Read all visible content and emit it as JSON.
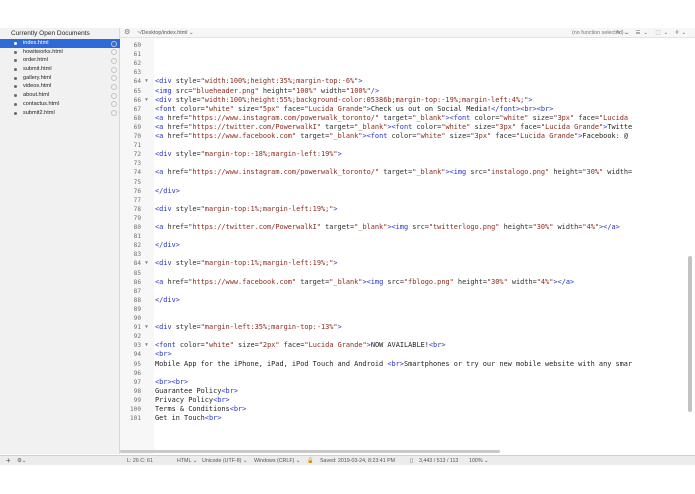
{
  "sidebar": {
    "header": "Currently Open Documents",
    "files": [
      "index.html",
      "howitworks.html",
      "order.html",
      "submit.html",
      "gallery.html",
      "videos.html",
      "about.html",
      "contactus.html",
      "submit2.html"
    ],
    "selected_index": 0
  },
  "topbar": {
    "gear": "⚙",
    "path": "~/Desktop/index.html ⌄",
    "function_menu": "(no function selected) ⌄",
    "icons": "✎⌄ ☰⌄ ⬚⌄ #⌄"
  },
  "editor": {
    "lines": [
      {
        "n": "60",
        "fold": "",
        "segs": []
      },
      {
        "n": "61",
        "fold": "",
        "segs": []
      },
      {
        "n": "62",
        "fold": "",
        "segs": []
      },
      {
        "n": "63",
        "fold": "",
        "segs": []
      },
      {
        "n": "64",
        "fold": "▼",
        "segs": [
          {
            "t": "<div ",
            "c": "t-tag"
          },
          {
            "t": "style=",
            "c": "t-attr"
          },
          {
            "t": "\"width:100%;height:35%;margin-top:-6%\"",
            "c": "t-val"
          },
          {
            "t": ">",
            "c": "t-tag"
          }
        ]
      },
      {
        "n": "65",
        "fold": "",
        "segs": [
          {
            "t": "<img ",
            "c": "t-tag"
          },
          {
            "t": "src=",
            "c": "t-attr"
          },
          {
            "t": "\"blueheader.png\" ",
            "c": "t-val"
          },
          {
            "t": "height=",
            "c": "t-attr"
          },
          {
            "t": "\"100%\" ",
            "c": "t-val"
          },
          {
            "t": "width=",
            "c": "t-attr"
          },
          {
            "t": "\"100%\"",
            "c": "t-val"
          },
          {
            "t": "/>",
            "c": "t-tag"
          }
        ]
      },
      {
        "n": "66",
        "fold": "▼",
        "segs": [
          {
            "t": "<div ",
            "c": "t-tag"
          },
          {
            "t": "style=",
            "c": "t-attr"
          },
          {
            "t": "\"width:100%;height:55%;background-color:05386b;margin-top:-19%;margin-left:4%;\"",
            "c": "t-val"
          },
          {
            "t": ">",
            "c": "t-tag"
          }
        ]
      },
      {
        "n": "67",
        "fold": "",
        "segs": [
          {
            "t": "<font ",
            "c": "t-tag"
          },
          {
            "t": "color=",
            "c": "t-attr"
          },
          {
            "t": "\"white\" ",
            "c": "t-val"
          },
          {
            "t": "size=",
            "c": "t-attr"
          },
          {
            "t": "\"5px\" ",
            "c": "t-val"
          },
          {
            "t": "face=",
            "c": "t-attr"
          },
          {
            "t": "\"Lucida Grande\"",
            "c": "t-val"
          },
          {
            "t": ">",
            "c": "t-tag"
          },
          {
            "t": "Check us out on Social Media!",
            "c": "t-text"
          },
          {
            "t": "</font><br><br>",
            "c": "t-tag"
          }
        ]
      },
      {
        "n": "68",
        "fold": "",
        "segs": [
          {
            "t": "<a ",
            "c": "t-tag"
          },
          {
            "t": "href=",
            "c": "t-attr"
          },
          {
            "t": "\"https://www.instagram.com/powerwalk_toronto/\" ",
            "c": "t-val"
          },
          {
            "t": "target=",
            "c": "t-attr"
          },
          {
            "t": "\"_blank\"",
            "c": "t-val"
          },
          {
            "t": "><font ",
            "c": "t-tag"
          },
          {
            "t": "color=",
            "c": "t-attr"
          },
          {
            "t": "\"white\" ",
            "c": "t-val"
          },
          {
            "t": "size=",
            "c": "t-attr"
          },
          {
            "t": "\"3px\" ",
            "c": "t-val"
          },
          {
            "t": "face=",
            "c": "t-attr"
          },
          {
            "t": "\"Lucida",
            "c": "t-val"
          }
        ]
      },
      {
        "n": "69",
        "fold": "",
        "segs": [
          {
            "t": "<a ",
            "c": "t-tag"
          },
          {
            "t": "href=",
            "c": "t-attr"
          },
          {
            "t": "\"https://twitter.com/PowerwalkI\" ",
            "c": "t-val"
          },
          {
            "t": "target=",
            "c": "t-attr"
          },
          {
            "t": "\"_blank\"",
            "c": "t-val"
          },
          {
            "t": "><font ",
            "c": "t-tag"
          },
          {
            "t": "color=",
            "c": "t-attr"
          },
          {
            "t": "\"white\" ",
            "c": "t-val"
          },
          {
            "t": "size=",
            "c": "t-attr"
          },
          {
            "t": "\"3px\" ",
            "c": "t-val"
          },
          {
            "t": "face=",
            "c": "t-attr"
          },
          {
            "t": "\"Lucida Grande\"",
            "c": "t-val"
          },
          {
            "t": ">",
            "c": "t-tag"
          },
          {
            "t": "Twitte",
            "c": "t-text"
          }
        ]
      },
      {
        "n": "70",
        "fold": "",
        "segs": [
          {
            "t": "<a ",
            "c": "t-tag"
          },
          {
            "t": "href=",
            "c": "t-attr"
          },
          {
            "t": "\"https://www.facebook.com\" ",
            "c": "t-val"
          },
          {
            "t": "target=",
            "c": "t-attr"
          },
          {
            "t": "\"_blank\"",
            "c": "t-val"
          },
          {
            "t": "><font ",
            "c": "t-tag"
          },
          {
            "t": "color=",
            "c": "t-attr"
          },
          {
            "t": "\"white\" ",
            "c": "t-val"
          },
          {
            "t": "size=",
            "c": "t-attr"
          },
          {
            "t": "\"3px\" ",
            "c": "t-val"
          },
          {
            "t": "face=",
            "c": "t-attr"
          },
          {
            "t": "\"Lucida Grande\"",
            "c": "t-val"
          },
          {
            "t": ">",
            "c": "t-tag"
          },
          {
            "t": "Facebook: @",
            "c": "t-text"
          }
        ]
      },
      {
        "n": "71",
        "fold": "",
        "segs": []
      },
      {
        "n": "72",
        "fold": "",
        "segs": [
          {
            "t": "<div ",
            "c": "t-tag"
          },
          {
            "t": "style=",
            "c": "t-attr"
          },
          {
            "t": "\"margin-top:-18%;margin-left:19%\"",
            "c": "t-val"
          },
          {
            "t": ">",
            "c": "t-tag"
          }
        ]
      },
      {
        "n": "73",
        "fold": "",
        "segs": []
      },
      {
        "n": "74",
        "fold": "",
        "segs": [
          {
            "t": "<a ",
            "c": "t-tag"
          },
          {
            "t": "href=",
            "c": "t-attr"
          },
          {
            "t": "\"https://www.instagram.com/powerwalk_toronto/\" ",
            "c": "t-val"
          },
          {
            "t": "target=",
            "c": "t-attr"
          },
          {
            "t": "\"_blank\"",
            "c": "t-val"
          },
          {
            "t": "><img ",
            "c": "t-tag"
          },
          {
            "t": "src=",
            "c": "t-attr"
          },
          {
            "t": "\"instalogo.png\" ",
            "c": "t-val"
          },
          {
            "t": "height=",
            "c": "t-attr"
          },
          {
            "t": "\"30%\" ",
            "c": "t-val"
          },
          {
            "t": "width=",
            "c": "t-attr"
          }
        ]
      },
      {
        "n": "75",
        "fold": "",
        "segs": []
      },
      {
        "n": "76",
        "fold": "",
        "segs": [
          {
            "t": "</div>",
            "c": "t-tag"
          }
        ]
      },
      {
        "n": "77",
        "fold": "",
        "segs": []
      },
      {
        "n": "78",
        "fold": "",
        "segs": [
          {
            "t": "<div ",
            "c": "t-tag"
          },
          {
            "t": "style=",
            "c": "t-attr"
          },
          {
            "t": "\"margin-top:1%;margin-left:19%;\"",
            "c": "t-val"
          },
          {
            "t": ">",
            "c": "t-tag"
          }
        ]
      },
      {
        "n": "79",
        "fold": "",
        "segs": []
      },
      {
        "n": "80",
        "fold": "",
        "segs": [
          {
            "t": "<a ",
            "c": "t-tag"
          },
          {
            "t": "href=",
            "c": "t-attr"
          },
          {
            "t": "\"https://twitter.com/PowerwalkI\" ",
            "c": "t-val"
          },
          {
            "t": "target=",
            "c": "t-attr"
          },
          {
            "t": "\"_blank\"",
            "c": "t-val"
          },
          {
            "t": "><img ",
            "c": "t-tag"
          },
          {
            "t": "src=",
            "c": "t-attr"
          },
          {
            "t": "\"twitterlogo.png\" ",
            "c": "t-val"
          },
          {
            "t": "height=",
            "c": "t-attr"
          },
          {
            "t": "\"30%\" ",
            "c": "t-val"
          },
          {
            "t": "width=",
            "c": "t-attr"
          },
          {
            "t": "\"4%\"",
            "c": "t-val"
          },
          {
            "t": "></a>",
            "c": "t-tag"
          }
        ]
      },
      {
        "n": "81",
        "fold": "",
        "segs": []
      },
      {
        "n": "82",
        "fold": "",
        "segs": [
          {
            "t": "</div>",
            "c": "t-tag"
          }
        ]
      },
      {
        "n": "83",
        "fold": "",
        "segs": []
      },
      {
        "n": "84",
        "fold": "▼",
        "segs": [
          {
            "t": "<div ",
            "c": "t-tag"
          },
          {
            "t": "style=",
            "c": "t-attr"
          },
          {
            "t": "\"margin-top:1%;margin-left:19%;\"",
            "c": "t-val"
          },
          {
            "t": ">",
            "c": "t-tag"
          }
        ]
      },
      {
        "n": "85",
        "fold": "",
        "segs": []
      },
      {
        "n": "86",
        "fold": "",
        "segs": [
          {
            "t": "<a ",
            "c": "t-tag"
          },
          {
            "t": "href=",
            "c": "t-attr"
          },
          {
            "t": "\"https://www.facebook.com\" ",
            "c": "t-val"
          },
          {
            "t": "target=",
            "c": "t-attr"
          },
          {
            "t": "\"_blank\"",
            "c": "t-val"
          },
          {
            "t": "><img ",
            "c": "t-tag"
          },
          {
            "t": "src=",
            "c": "t-attr"
          },
          {
            "t": "\"fblogo.png\" ",
            "c": "t-val"
          },
          {
            "t": "height=",
            "c": "t-attr"
          },
          {
            "t": "\"30%\" ",
            "c": "t-val"
          },
          {
            "t": "width=",
            "c": "t-attr"
          },
          {
            "t": "\"4%\"",
            "c": "t-val"
          },
          {
            "t": "></a>",
            "c": "t-tag"
          }
        ]
      },
      {
        "n": "87",
        "fold": "",
        "segs": []
      },
      {
        "n": "88",
        "fold": "",
        "segs": [
          {
            "t": "</div>",
            "c": "t-tag"
          }
        ]
      },
      {
        "n": "89",
        "fold": "",
        "segs": []
      },
      {
        "n": "90",
        "fold": "",
        "segs": []
      },
      {
        "n": "91",
        "fold": "▼",
        "segs": [
          {
            "t": "<div ",
            "c": "t-tag"
          },
          {
            "t": "style=",
            "c": "t-attr"
          },
          {
            "t": "\"margin-left:35%;margin-top:-13%\"",
            "c": "t-val"
          },
          {
            "t": ">",
            "c": "t-tag"
          }
        ]
      },
      {
        "n": "92",
        "fold": "",
        "segs": []
      },
      {
        "n": "93",
        "fold": "▼",
        "segs": [
          {
            "t": "<font ",
            "c": "t-tag"
          },
          {
            "t": "color=",
            "c": "t-attr"
          },
          {
            "t": "\"white\" ",
            "c": "t-val"
          },
          {
            "t": "size=",
            "c": "t-attr"
          },
          {
            "t": "\"2px\" ",
            "c": "t-val"
          },
          {
            "t": "face=",
            "c": "t-attr"
          },
          {
            "t": "\"Lucida Grande\"",
            "c": "t-val"
          },
          {
            "t": ">",
            "c": "t-tag"
          },
          {
            "t": "NOW AVAILABLE!",
            "c": "t-text"
          },
          {
            "t": "<br>",
            "c": "t-tag"
          }
        ]
      },
      {
        "n": "94",
        "fold": "",
        "segs": [
          {
            "t": "<br>",
            "c": "t-tag"
          }
        ]
      },
      {
        "n": "95",
        "fold": "",
        "segs": [
          {
            "t": "Mobile App for the iPhone, iPad, iPod Touch and Android ",
            "c": "t-text"
          },
          {
            "t": "<br>",
            "c": "t-tag"
          },
          {
            "t": "Smartphones or try our new mobile website with any smar",
            "c": "t-text"
          }
        ]
      },
      {
        "n": "96",
        "fold": "",
        "segs": []
      },
      {
        "n": "97",
        "fold": "",
        "segs": [
          {
            "t": "<br><br>",
            "c": "t-tag"
          }
        ]
      },
      {
        "n": "98",
        "fold": "",
        "segs": [
          {
            "t": "Guarantee Policy",
            "c": "t-text"
          },
          {
            "t": "<br>",
            "c": "t-tag"
          }
        ]
      },
      {
        "n": "99",
        "fold": "",
        "segs": [
          {
            "t": "Privacy Policy",
            "c": "t-text"
          },
          {
            "t": "<br>",
            "c": "t-tag"
          }
        ]
      },
      {
        "n": "100",
        "fold": "",
        "segs": [
          {
            "t": "Terms & Conditions",
            "c": "t-text"
          },
          {
            "t": "<br>",
            "c": "t-tag"
          }
        ]
      },
      {
        "n": "101",
        "fold": "",
        "segs": [
          {
            "t": "Get in Touch",
            "c": "t-text"
          },
          {
            "t": "<br>",
            "c": "t-tag"
          }
        ]
      }
    ]
  },
  "statusbar": {
    "add": "+",
    "gear": "⚙⌄",
    "position": "L: 26 C: 61",
    "language": "HTML ⌄",
    "encoding": "Unicode (UTF-8) ⌄",
    "line_endings": "Windows (CRLF) ⌄",
    "lock": "🔓",
    "saved": "Saved: 2019-03-24, 8:23:41 PM",
    "doc_icon": "▯",
    "stats": "3,443 / 513 / 113",
    "zoom": "100% ⌄"
  },
  "colors": {
    "tag": "#2431c8",
    "value": "#8b2a1c",
    "selection": "#2f6bd8"
  }
}
